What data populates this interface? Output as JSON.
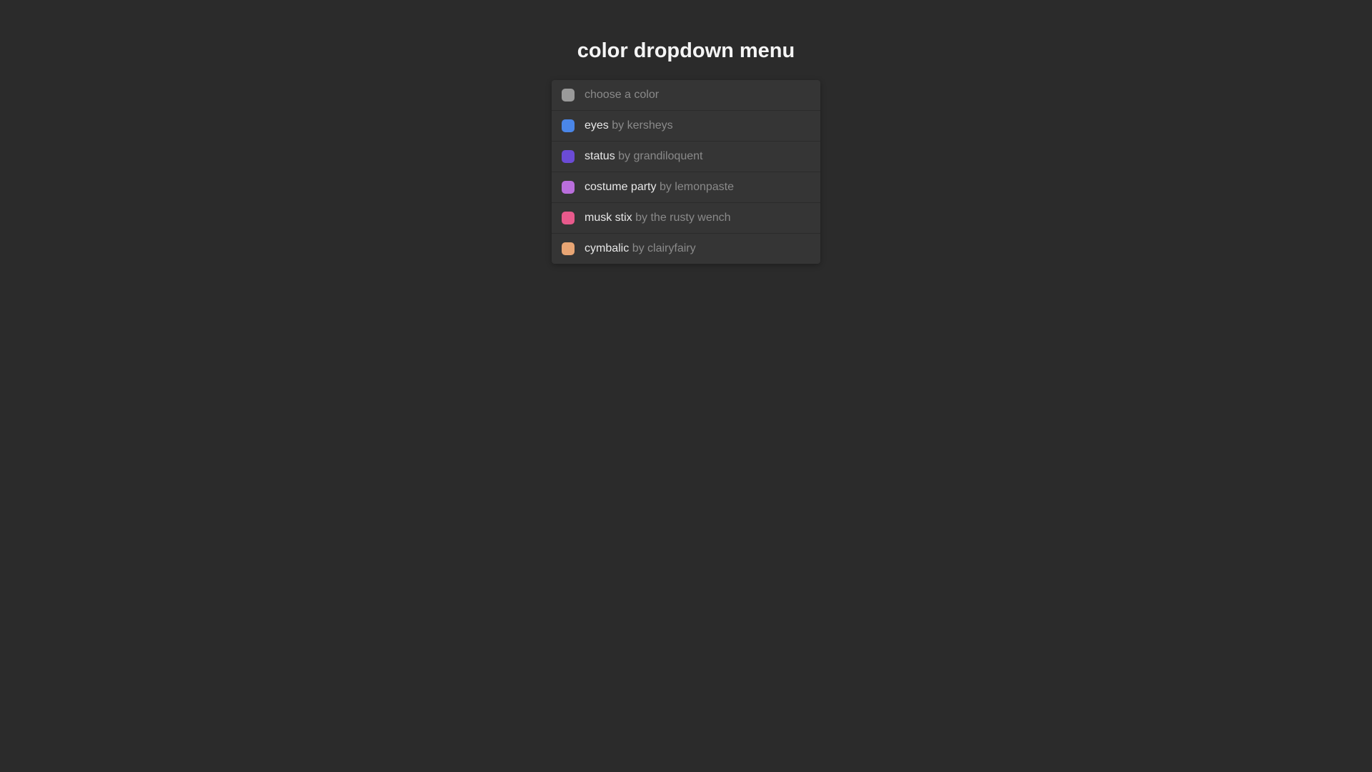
{
  "title": "color dropdown menu",
  "placeholder": {
    "swatch_color": "#9a9a9a",
    "label": "choose a color"
  },
  "items": [
    {
      "swatch_color": "#4a86e8",
      "name": "eyes",
      "byline": "by kersheys"
    },
    {
      "swatch_color": "#6b4bd6",
      "name": "status",
      "byline": "by grandiloquent"
    },
    {
      "swatch_color": "#b96edc",
      "name": "costume party",
      "byline": "by lemonpaste"
    },
    {
      "swatch_color": "#e85a8c",
      "name": "musk stix",
      "byline": "by the rusty wench"
    },
    {
      "swatch_color": "#e8a574",
      "name": "cymbalic",
      "byline": "by clairyfairy"
    }
  ]
}
